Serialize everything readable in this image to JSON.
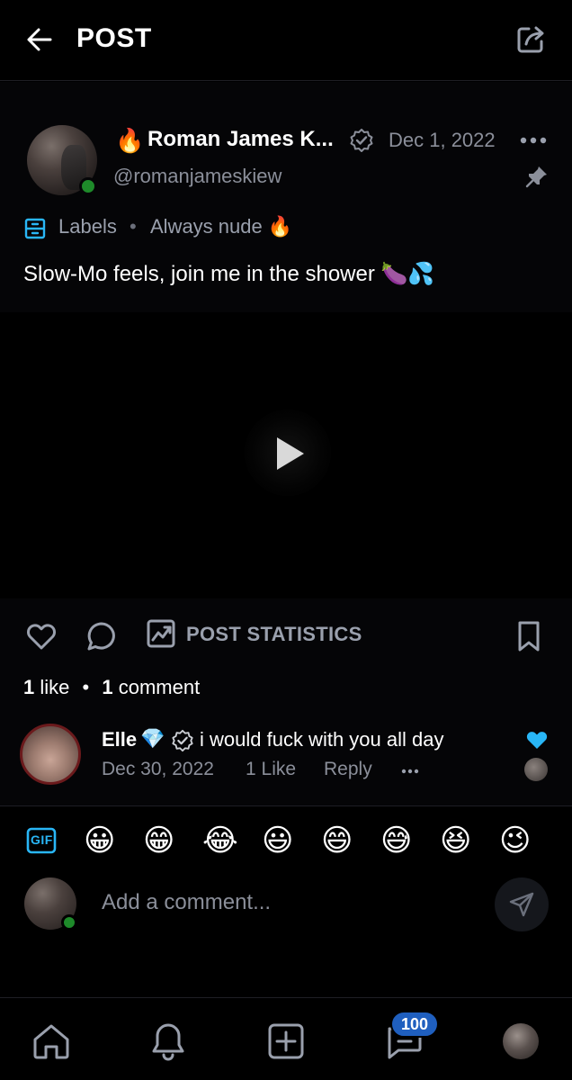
{
  "header": {
    "title": "POST"
  },
  "post": {
    "author_emoji": "🔥",
    "author_name": "Roman James K...",
    "date": "Dec 1, 2022",
    "handle": "@romanjameskiew",
    "labels_label": "Labels",
    "labels_separator": "•",
    "label_value": "Always nude",
    "label_emoji": "🔥",
    "text": "Slow-Mo feels, join me in the shower 🍆💦"
  },
  "actions": {
    "stats_label": "POST STATISTICS",
    "likes_count": "1",
    "likes_word": "like",
    "comments_count": "1",
    "comments_word": "comment",
    "separator": "•"
  },
  "comments": [
    {
      "name": "Elle",
      "badge": "💎",
      "text": "i would fuck with you all day",
      "date": "Dec 30, 2022",
      "likes": "1 Like",
      "reply_label": "Reply"
    }
  ],
  "composer": {
    "gif_label": "GIF",
    "emojis": [
      "😀",
      "😁",
      "😂",
      "😃",
      "😄",
      "😅",
      "😆",
      "😉"
    ],
    "placeholder": "Add a comment..."
  },
  "nav": {
    "messages_badge": "100"
  },
  "colors": {
    "background": "#000000",
    "muted_text": "#8b8f9a",
    "accent_blue": "#29b6f6",
    "online_green": "#1e8a2a",
    "badge_blue": "#1f5fbf"
  },
  "icons": [
    "back-arrow-icon",
    "share-icon",
    "verified-icon",
    "more-icon",
    "pin-icon",
    "labels-icon",
    "play-icon",
    "heart-icon",
    "comment-icon",
    "stats-icon",
    "bookmark-icon",
    "send-icon",
    "home-icon",
    "bell-icon",
    "add-post-icon",
    "messages-icon"
  ]
}
